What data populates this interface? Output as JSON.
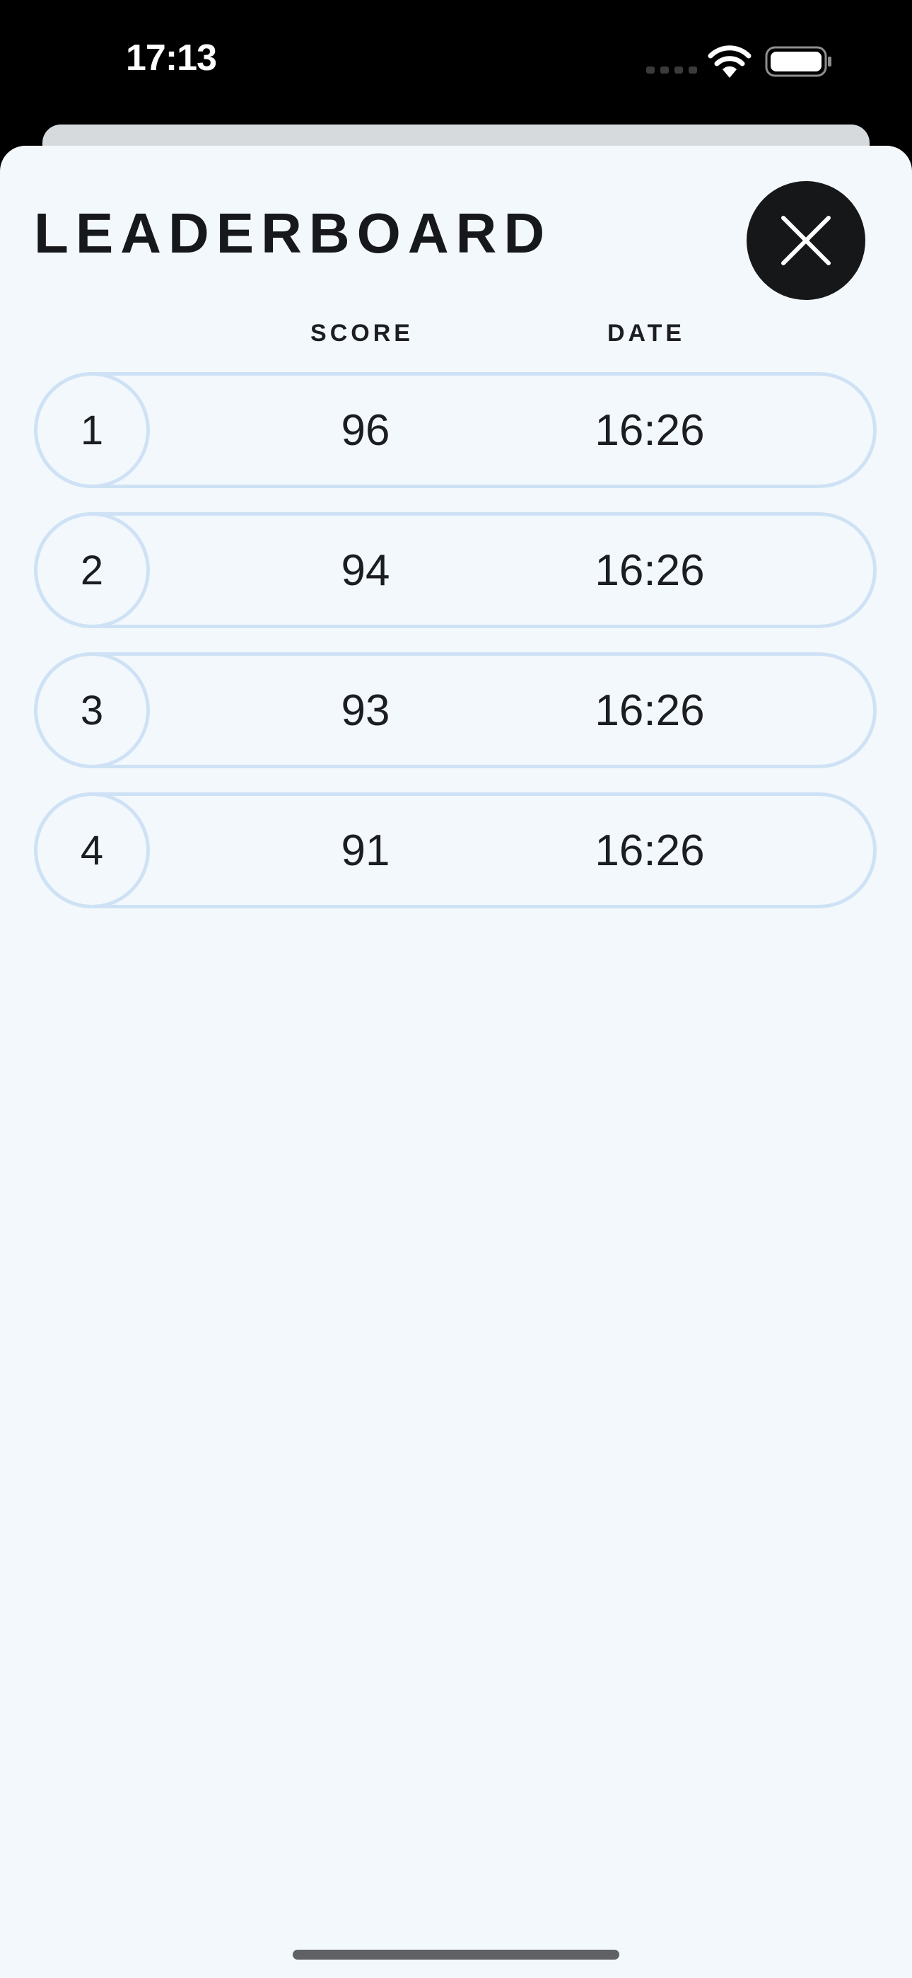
{
  "status_bar": {
    "time": "17:13",
    "icons": [
      "cellular-signal-icon",
      "wifi-icon",
      "battery-icon"
    ]
  },
  "leaderboard": {
    "title": "LEADERBOARD",
    "close_icon": "close-icon",
    "columns": {
      "score": "SCORE",
      "date": "DATE"
    },
    "rows": [
      {
        "rank": "1",
        "score": "96",
        "date": "16:26"
      },
      {
        "rank": "2",
        "score": "94",
        "date": "16:26"
      },
      {
        "rank": "3",
        "score": "93",
        "date": "16:26"
      },
      {
        "rank": "4",
        "score": "91",
        "date": "16:26"
      }
    ]
  },
  "colors": {
    "background": "#f2f8fc",
    "row_border": "#cfe2f5",
    "text": "#1b1d20",
    "close_button": "#161718"
  }
}
